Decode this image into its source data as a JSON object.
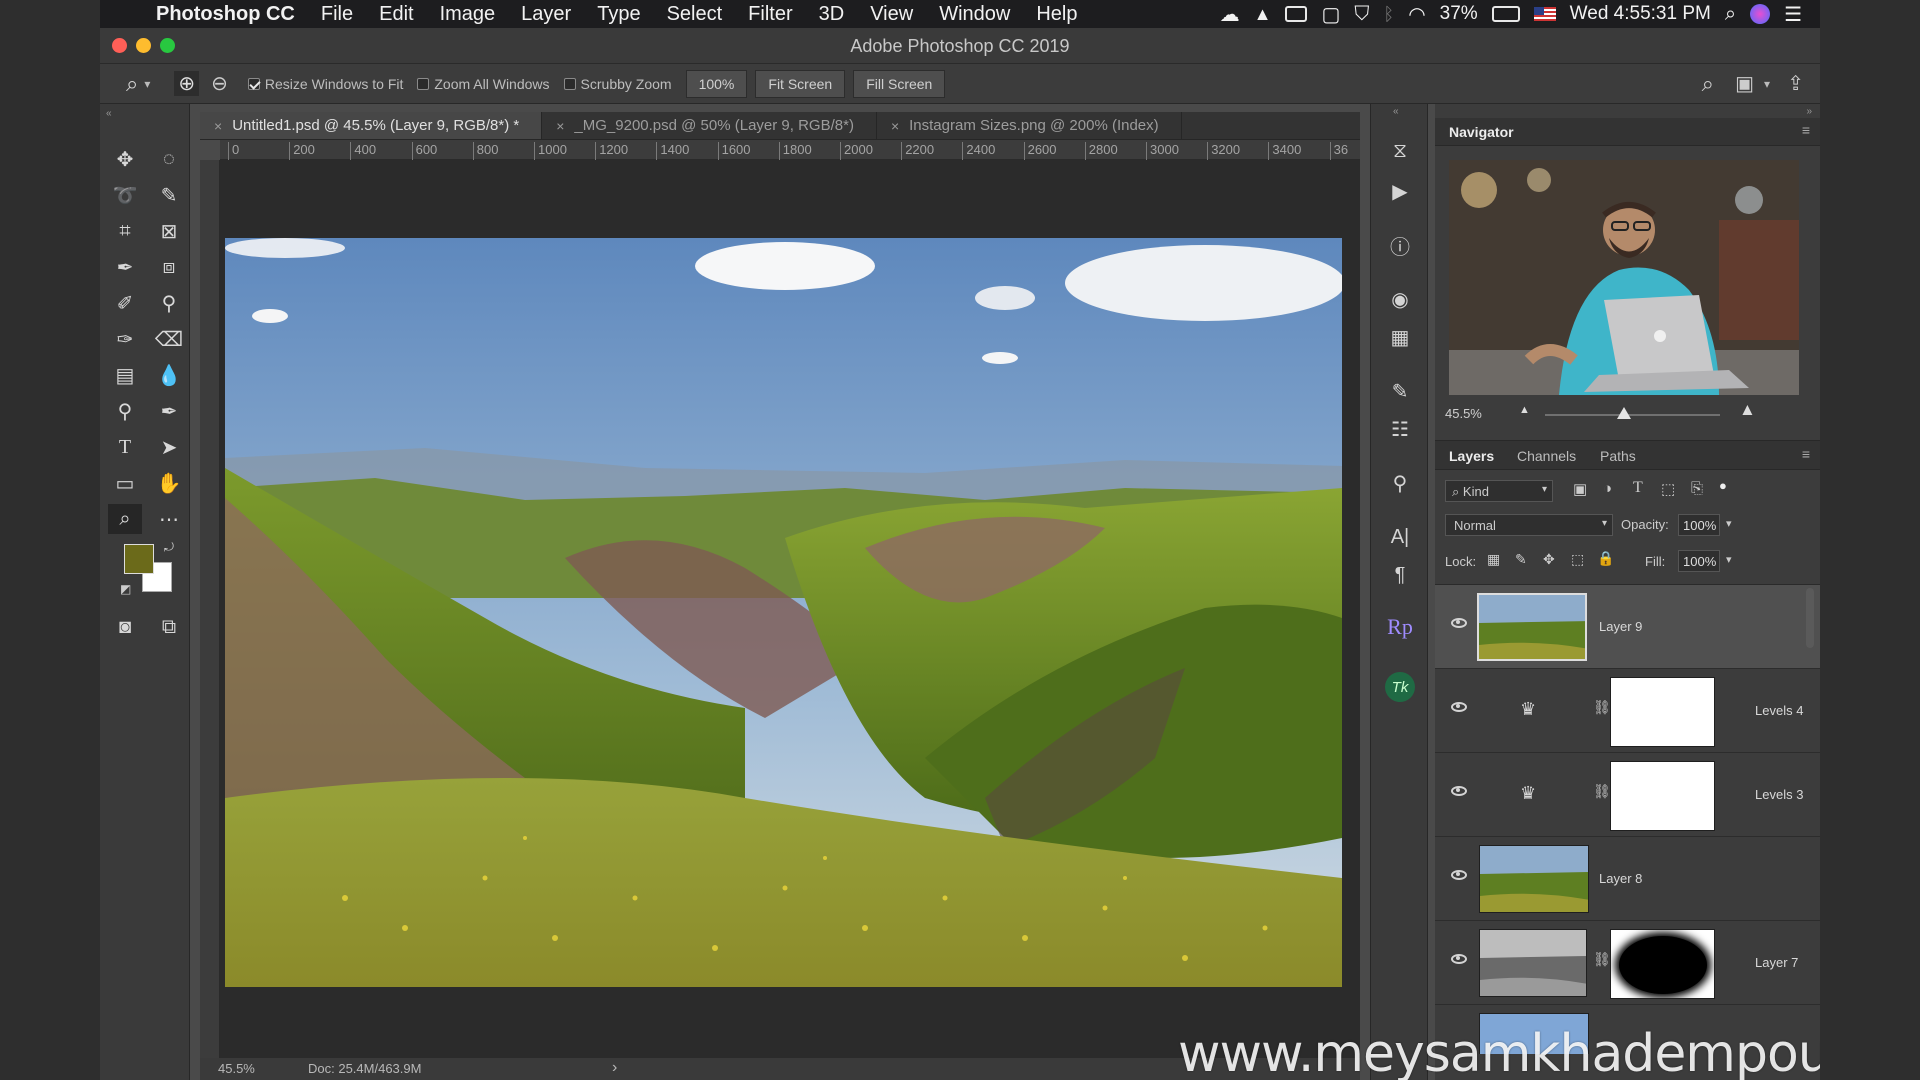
{
  "menubar": {
    "apple_glyph": "",
    "app_name": "Photoshop CC",
    "items": [
      "File",
      "Edit",
      "Image",
      "Layer",
      "Type",
      "Select",
      "Filter",
      "3D",
      "View",
      "Window",
      "Help"
    ],
    "battery": "37%",
    "clock": "Wed 4:55:31 PM"
  },
  "window": {
    "title": "Adobe Photoshop CC 2019"
  },
  "options_bar": {
    "resize_windows": {
      "label": "Resize Windows to Fit",
      "checked": true
    },
    "zoom_all": {
      "label": "Zoom All Windows",
      "checked": false
    },
    "scrubby_zoom": {
      "label": "Scrubby Zoom",
      "checked": false
    },
    "zoom_value": "100%",
    "fit_screen": "Fit Screen",
    "fill_screen": "Fill Screen"
  },
  "document_tabs": [
    {
      "label": "Untitled1.psd @ 45.5% (Layer 9, RGB/8*) *",
      "active": true
    },
    {
      "label": "_MG_9200.psd @ 50% (Layer 9, RGB/8*)",
      "active": false
    },
    {
      "label": "Instagram Sizes.png @ 200% (Index)",
      "active": false
    }
  ],
  "ruler": {
    "top_ticks": [
      "0",
      "200",
      "400",
      "600",
      "800",
      "1000",
      "1200",
      "1400",
      "1600",
      "1800",
      "2000",
      "2200",
      "2400",
      "2600",
      "2800",
      "3000",
      "3200",
      "3400",
      "36"
    ]
  },
  "status": {
    "zoom": "45.5%",
    "doc": "Doc: 25.4M/463.9M",
    "arrow": "›"
  },
  "navigator": {
    "title": "Navigator",
    "zoom": "45.5%",
    "zoom_fraction": 0.45
  },
  "layers_panel": {
    "tabs": [
      "Layers",
      "Channels",
      "Paths"
    ],
    "filter_label": "Kind",
    "blend_mode": "Normal",
    "opacity_label": "Opacity:",
    "opacity_value": "100%",
    "lock_label": "Lock:",
    "fill_label": "Fill:",
    "fill_value": "100%",
    "layers": [
      {
        "name": "Layer 9",
        "kind": "pixel",
        "selected": true
      },
      {
        "name": "Levels 4",
        "kind": "adjustment"
      },
      {
        "name": "Levels 3",
        "kind": "adjustment"
      },
      {
        "name": "Layer 8",
        "kind": "pixel"
      },
      {
        "name": "Layer 7",
        "kind": "pixel-with-mask"
      }
    ]
  },
  "side_icons": {
    "rp_label": "Rp",
    "tk_label": "Tk"
  },
  "colors": {
    "foreground": "#6b6a1a",
    "background": "#ffffff",
    "close_btn": "#ff5f57",
    "min_btn": "#febc2e",
    "max_btn": "#28c840"
  },
  "watermark": "www.meysamkhadempour.com"
}
